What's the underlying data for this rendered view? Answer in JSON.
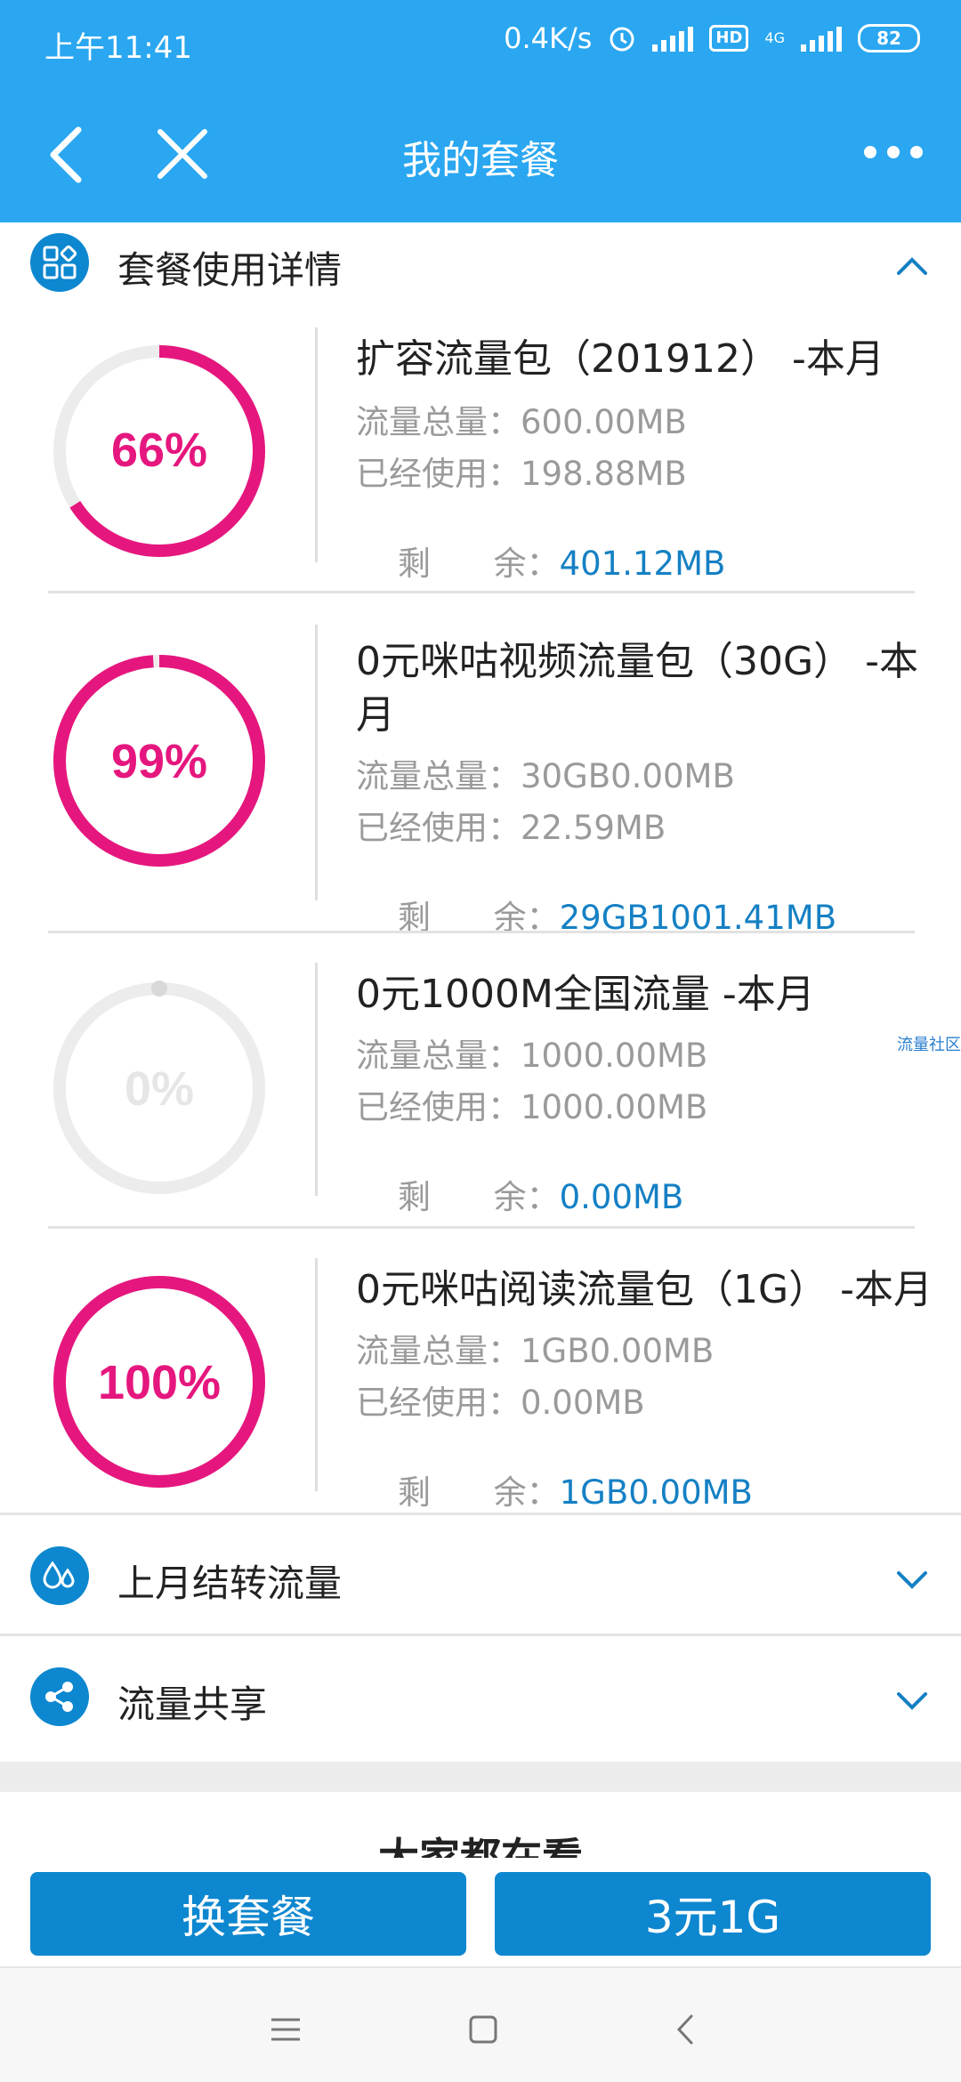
{
  "status_bar": {
    "time": "上午11:41",
    "speed": "0.4K/s",
    "hd_badge": "HD",
    "network": "4G",
    "battery": "82"
  },
  "header": {
    "title": "我的套餐",
    "icons": [
      "back-arrow-icon",
      "close-icon",
      "more-dots-icon"
    ]
  },
  "sections": {
    "usage_detail": {
      "label": "套餐使用详情",
      "expanded": true,
      "icon": "grid-apps-icon"
    },
    "last_month": {
      "label": "上月结转流量",
      "expanded": false,
      "icon": "water-drops-icon"
    },
    "share": {
      "label": "流量共享",
      "expanded": false,
      "icon": "share-icon"
    }
  },
  "labels": {
    "total": "流量总量：",
    "used": "已经使用：",
    "remaining": "剩      余："
  },
  "packages": [
    {
      "name": "扩容流量包（201912） -本月",
      "percent_label": "66%",
      "percent": 66,
      "total": "600.00MB",
      "used": "198.88MB",
      "remaining": "401.12MB"
    },
    {
      "name_line1": "0元咪咕视频流量包（30G） -本",
      "name_line2": "月",
      "percent_label": "99%",
      "percent": 99,
      "total": "30GB0.00MB",
      "used": "22.59MB",
      "remaining": "29GB1001.41MB"
    },
    {
      "name": "0元1000M全国流量 -本月",
      "percent_label": "0%",
      "percent": 0,
      "total": "1000.00MB",
      "used": "1000.00MB",
      "remaining": "0.00MB"
    },
    {
      "name": "0元咪咕阅读流量包（1G） -本月",
      "percent_label": "100%",
      "percent": 100,
      "total": "1GB0.00MB",
      "used": "0.00MB",
      "remaining": "1GB0.00MB"
    }
  ],
  "watermark": "流量社区",
  "recommend_title": "大家都在看",
  "buttons": {
    "change_plan": "换套餐",
    "promo": "3元1G"
  },
  "colors": {
    "brand_blue": "#2aa7f0",
    "button_blue": "#0d87cf",
    "ring_pink": "#e5177e",
    "ring_gray": "#ececec",
    "value_blue": "#1580c4"
  }
}
